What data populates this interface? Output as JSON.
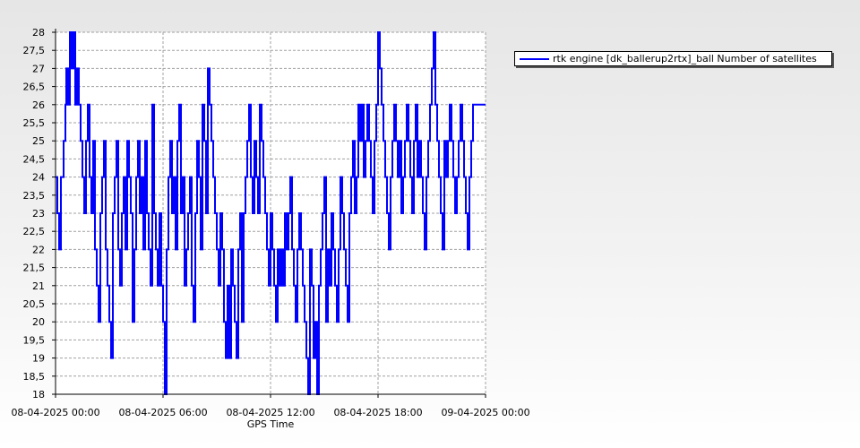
{
  "chart_data": {
    "type": "line",
    "xlabel": "GPS Time",
    "ylabel": "",
    "title": "",
    "x_range": [
      "08-04-2025 00:00",
      "09-04-2025 00:00"
    ],
    "x_ticks": [
      "08-04-2025 00:00",
      "08-04-2025 06:00",
      "08-04-2025 12:00",
      "08-04-2025 18:00",
      "09-04-2025 00:00"
    ],
    "ylim": [
      18,
      28
    ],
    "y_ticks": [
      "18",
      "18,5",
      "19",
      "19,5",
      "20",
      "20,5",
      "21",
      "21,5",
      "22",
      "22,5",
      "23",
      "23,5",
      "24",
      "24,5",
      "25",
      "25,5",
      "26",
      "26,5",
      "27",
      "27,5",
      "28"
    ],
    "grid": true,
    "legend_position": "top-right",
    "series": [
      {
        "name": "rtk engine [dk_ballerup2rtx]_ball Number of satellites",
        "color": "#0000ff",
        "x_hours": [
          0,
          0.1,
          0.2,
          0.3,
          0.45,
          0.55,
          0.6,
          0.7,
          0.8,
          0.9,
          1.0,
          1.1,
          1.2,
          1.3,
          1.4,
          1.5,
          1.6,
          1.7,
          1.8,
          1.9,
          2.0,
          2.1,
          2.2,
          2.3,
          2.4,
          2.5,
          2.6,
          2.7,
          2.8,
          2.9,
          3.0,
          3.1,
          3.2,
          3.3,
          3.4,
          3.5,
          3.6,
          3.7,
          3.8,
          3.9,
          4.0,
          4.1,
          4.2,
          4.3,
          4.4,
          4.5,
          4.6,
          4.7,
          4.8,
          4.9,
          5.0,
          5.1,
          5.2,
          5.3,
          5.4,
          5.5,
          5.6,
          5.7,
          5.8,
          5.9,
          6.0,
          6.1,
          6.2,
          6.3,
          6.4,
          6.5,
          6.6,
          6.7,
          6.8,
          6.9,
          7.0,
          7.1,
          7.2,
          7.3,
          7.4,
          7.5,
          7.6,
          7.7,
          7.8,
          7.9,
          8.0,
          8.1,
          8.2,
          8.3,
          8.4,
          8.5,
          8.6,
          8.7,
          8.8,
          8.9,
          9.0,
          9.1,
          9.2,
          9.3,
          9.4,
          9.5,
          9.6,
          9.7,
          9.8,
          9.9,
          10.0,
          10.1,
          10.2,
          10.3,
          10.4,
          10.5,
          10.6,
          10.7,
          10.8,
          10.9,
          11.0,
          11.1,
          11.2,
          11.3,
          11.4,
          11.5,
          11.6,
          11.7,
          11.8,
          11.9,
          12.0,
          12.1,
          12.2,
          12.3,
          12.4,
          12.5,
          12.6,
          12.7,
          12.8,
          12.9,
          13.0,
          13.1,
          13.2,
          13.3,
          13.4,
          13.5,
          13.6,
          13.7,
          13.8,
          13.9,
          14.0,
          14.1,
          14.2,
          14.3,
          14.4,
          14.5,
          14.6,
          14.7,
          14.8,
          14.9,
          15.0,
          15.1,
          15.2,
          15.3,
          15.4,
          15.5,
          15.6,
          15.7,
          15.8,
          15.9,
          16.0,
          16.1,
          16.2,
          16.3,
          16.4,
          16.5,
          16.6,
          16.7,
          16.8,
          16.9,
          17.0,
          17.1,
          17.2,
          17.3,
          17.4,
          17.5,
          17.6,
          17.7,
          17.8,
          17.9,
          18.0,
          18.1,
          18.2,
          18.3,
          18.4,
          18.5,
          18.6,
          18.7,
          18.8,
          18.9,
          19.0,
          19.1,
          19.2,
          19.3,
          19.4,
          19.5,
          19.6,
          19.7,
          19.8,
          19.9,
          20.0,
          20.1,
          20.2,
          20.3,
          20.4,
          20.5,
          20.6,
          20.7,
          20.8,
          20.9,
          21.0,
          21.1,
          21.2,
          21.3,
          21.4,
          21.5,
          21.6,
          21.7,
          21.8,
          21.9,
          22.0,
          22.1,
          22.2,
          22.3,
          22.4,
          22.5,
          22.6,
          22.7,
          22.8,
          22.9,
          23.0,
          23.1,
          23.2,
          23.3,
          23.4,
          23.5,
          23.6,
          23.7,
          23.8,
          23.9
        ],
        "values": [
          24,
          23,
          22,
          24,
          25,
          26,
          27,
          26,
          28,
          27,
          28,
          26,
          27,
          26,
          25,
          24,
          23,
          25,
          26,
          24,
          23,
          25,
          22,
          21,
          20,
          23,
          24,
          25,
          22,
          21,
          20,
          19,
          23,
          24,
          25,
          22,
          21,
          23,
          24,
          22,
          25,
          24,
          23,
          20,
          22,
          24,
          25,
          23,
          24,
          22,
          25,
          23,
          22,
          21,
          26,
          23,
          22,
          21,
          23,
          21,
          20,
          18,
          22,
          24,
          25,
          23,
          24,
          22,
          25,
          26,
          23,
          24,
          21,
          22,
          23,
          24,
          21,
          20,
          23,
          25,
          24,
          22,
          26,
          25,
          23,
          27,
          26,
          25,
          24,
          23,
          22,
          21,
          23,
          22,
          20,
          19,
          21,
          19,
          22,
          21,
          20,
          19,
          22,
          23,
          20,
          23,
          24,
          25,
          26,
          24,
          23,
          25,
          24,
          23,
          26,
          25,
          24,
          23,
          22,
          21,
          23,
          22,
          21,
          20,
          22,
          21,
          22,
          21,
          23,
          22,
          23,
          24,
          22,
          21,
          20,
          22,
          23,
          22,
          21,
          20,
          19,
          18,
          22,
          21,
          19,
          20,
          18,
          21,
          22,
          23,
          24,
          20,
          22,
          21,
          23,
          22,
          21,
          20,
          22,
          24,
          23,
          22,
          21,
          20,
          23,
          24,
          25,
          23,
          24,
          26,
          25,
          26,
          24,
          25,
          26,
          25,
          24,
          23,
          25,
          26,
          28,
          27,
          26,
          25,
          24,
          23,
          22,
          24,
          25,
          26,
          25,
          24,
          25,
          23,
          24,
          25,
          26,
          25,
          24,
          23,
          25,
          26,
          24,
          25,
          24,
          23,
          22,
          24,
          25,
          26,
          27,
          28,
          26,
          25,
          24,
          23,
          22,
          25,
          24,
          25,
          26,
          25,
          24,
          23,
          24,
          25,
          26,
          25,
          24,
          23,
          22,
          24,
          25,
          26
        ]
      }
    ]
  }
}
